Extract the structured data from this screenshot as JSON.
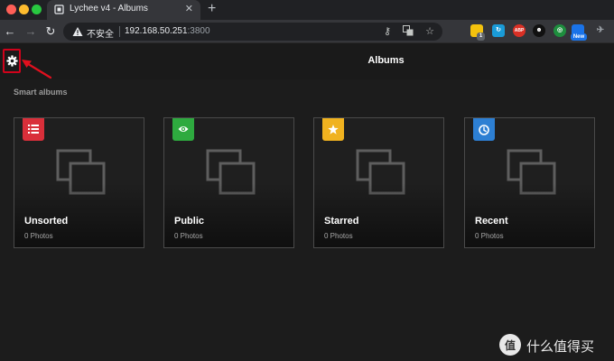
{
  "browser": {
    "tab_title": "Lychee v4 - Albums",
    "tab_close": "✕",
    "new_tab": "+",
    "security_label": "不安全",
    "url_host": "192.168.50.251",
    "url_port": ":3800",
    "ext_badge_count": "1",
    "ext_abp": "ABP",
    "ext_new": "New"
  },
  "app": {
    "title": "Albums",
    "section_label": "Smart albums",
    "accent_color": "#d0021b"
  },
  "albums": [
    {
      "title": "Unsorted",
      "count": "0 Photos",
      "badge_color": "#d92f3a",
      "badge_icon": "list-icon"
    },
    {
      "title": "Public",
      "count": "0 Photos",
      "badge_color": "#2eaa3f",
      "badge_icon": "eye-icon"
    },
    {
      "title": "Starred",
      "count": "0 Photos",
      "badge_color": "#f0b21f",
      "badge_icon": "star-icon"
    },
    {
      "title": "Recent",
      "count": "0 Photos",
      "badge_color": "#2d7fd3",
      "badge_icon": "clock-icon"
    }
  ],
  "watermark": {
    "logo_char": "值",
    "text": "什么值得买"
  }
}
